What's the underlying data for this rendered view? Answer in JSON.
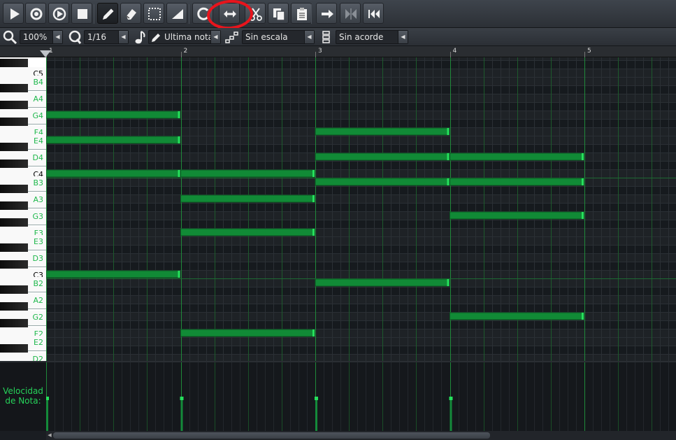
{
  "toolbar": {
    "buttons": [
      {
        "name": "play-button",
        "icon": "play-icon"
      },
      {
        "name": "record-button",
        "icon": "record-icon"
      },
      {
        "name": "record-while-playing-button",
        "icon": "record-play-icon"
      },
      {
        "name": "stop-button",
        "icon": "stop-icon"
      },
      {
        "name": "draw-mode-button",
        "icon": "pencil-icon",
        "active": true
      },
      {
        "name": "erase-mode-button",
        "icon": "eraser-icon"
      },
      {
        "name": "select-mode-button",
        "icon": "selection-icon"
      },
      {
        "name": "detune-mode-button",
        "icon": "ramp-icon"
      },
      {
        "name": "quantize-button",
        "icon": "circle-arrow-icon"
      },
      {
        "name": "stretch-button",
        "icon": "double-arrow-icon"
      },
      {
        "name": "cut-button",
        "icon": "scissors-icon"
      },
      {
        "name": "copy-button",
        "icon": "copy-icon"
      },
      {
        "name": "paste-button",
        "icon": "paste-icon"
      },
      {
        "name": "autoscroll-button",
        "icon": "right-arrow-icon"
      },
      {
        "name": "loop-points-button",
        "icon": "loop-points-icon"
      },
      {
        "name": "stop-behaviour-button",
        "icon": "back-to-start-icon"
      }
    ]
  },
  "toolbar2": {
    "zoom": "100%",
    "quantize": "1/16",
    "note_length": "Ultima nota",
    "scale": "Sin escala",
    "chord": "Sin acorde"
  },
  "ruler": {
    "bars": [
      "1",
      "2",
      "3",
      "4",
      "5"
    ]
  },
  "piano": {
    "white_keys": [
      "C5",
      "B4",
      "A4",
      "G4",
      "F4",
      "E4",
      "D4",
      "C4",
      "B3",
      "A3",
      "G3",
      "F3",
      "E3",
      "D3",
      "C3",
      "B2",
      "A2",
      "G2",
      "F2",
      "E2",
      "D2"
    ],
    "label_color_c": "#000000",
    "label_color_other": "#1fb84c"
  },
  "notes": [
    {
      "key": "G4",
      "start": 0,
      "length": 1
    },
    {
      "key": "E4",
      "start": 0,
      "length": 1
    },
    {
      "key": "C4",
      "start": 0,
      "length": 1
    },
    {
      "key": "C3",
      "start": 0,
      "length": 1
    },
    {
      "key": "C4",
      "start": 1,
      "length": 1
    },
    {
      "key": "A3",
      "start": 1,
      "length": 1
    },
    {
      "key": "F3",
      "start": 1,
      "length": 1
    },
    {
      "key": "F2",
      "start": 1,
      "length": 1
    },
    {
      "key": "F4",
      "start": 2,
      "length": 1
    },
    {
      "key": "D4",
      "start": 2,
      "length": 1
    },
    {
      "key": "B3",
      "start": 2,
      "length": 1
    },
    {
      "key": "B2",
      "start": 2,
      "length": 1
    },
    {
      "key": "D4",
      "start": 3,
      "length": 1
    },
    {
      "key": "B3",
      "start": 3,
      "length": 1
    },
    {
      "key": "G3",
      "start": 3,
      "length": 1
    },
    {
      "key": "G2",
      "start": 3,
      "length": 1
    }
  ],
  "velocity": {
    "label_line1": "Velocidad",
    "label_line2": "de Nota:"
  },
  "colors": {
    "note_fill": "#118a36",
    "note_border": "#0b5a23",
    "note_edge": "#26e05c",
    "grid_bar_line": "#1f8a3a",
    "highlight": "#e8141c"
  }
}
